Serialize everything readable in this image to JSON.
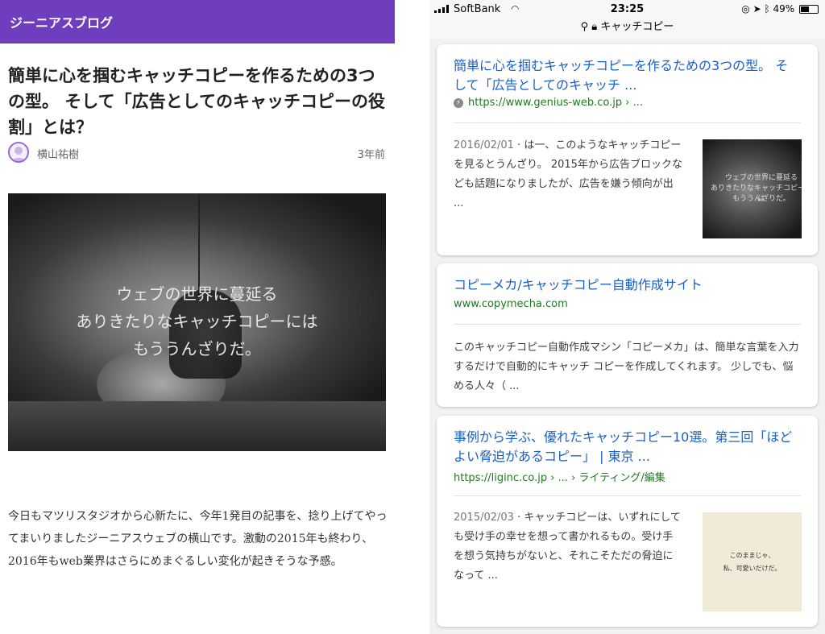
{
  "blog": {
    "site_name": "ジーニアスブログ",
    "title": "簡単に心を掴むキャッチコピーを作るための3つの型。 そして「広告としてのキャッチコピーの役割」とは？",
    "author": "横山祐樹",
    "age": "3年前",
    "hero_text": [
      "ウェブの世界に蔓延る",
      "ありきたりなキャッチコピーには",
      "もううんざりだ。"
    ],
    "body": "今日もマツリスタジオから心新たに、今年1発目の記事を、捻り上げてやってまいりましたジーニアスウェブの横山です。激動の2015年も終わり、2016年もweb業界はさらにめまぐるしい変化が起きそうな予感。"
  },
  "status": {
    "carrier": "SoftBank",
    "time": "23:25",
    "battery": "49%",
    "url": "キャッチコピー"
  },
  "results": [
    {
      "title": "簡単に心を掴むキャッチコピーを作るための3つの型。 そして「広告としてのキャッチ ...",
      "cite": "https://www.genius-web.co.jp › ...",
      "date": "2016/02/01",
      "snippet": "は一、このようなキャッチコピーを見るとうんざり。 2015年から広告ブロックなども話題になりましたが、広告を嫌う傾向が出 ...",
      "thumb_text": [
        "ウェブの世界に蔓延る",
        "ありきたりなキャッチコピーには",
        "もううんざりだ。"
      ]
    },
    {
      "title": "コピーメカ/キャッチコピー自動作成サイト",
      "cite": "www.copymecha.com",
      "snippet": "このキャッチコピー自動作成マシン「コピーメカ」は、簡単な言葉を入力するだけで自動的にキャッチ コピーを作成してくれます。 少しでも、悩める人々（ ..."
    },
    {
      "title": "事例から学ぶ、優れたキャッチコピー10選。第三回「ほどよい脅迫があるコピー」 | 東京 ...",
      "cite": "https://liginc.co.jp › ... › ライティング/編集",
      "date": "2015/02/03",
      "snippet": "キャッチコピーは、いずれにしても受け手の幸せを想って書かれるもの。受け手を想う気持ちがないと、それこそただの脅迫になって ...",
      "thumb_text": [
        "このままじゃ、",
        "私、可愛いだけだ。"
      ]
    }
  ]
}
